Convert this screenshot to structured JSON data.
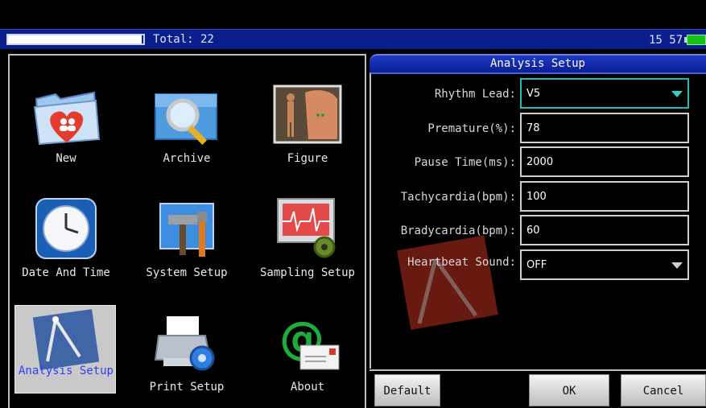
{
  "status_bar": {
    "progress_fraction": 0.99,
    "total_label": "Total: 22",
    "time": "15 57"
  },
  "menu": {
    "items": [
      {
        "label": "New",
        "icon": "new-folder-heart-icon"
      },
      {
        "label": "Archive",
        "icon": "archive-magnifier-icon"
      },
      {
        "label": "Figure",
        "icon": "figure-body-icon"
      },
      {
        "label": "Date And Time",
        "icon": "clock-icon"
      },
      {
        "label": "System Setup",
        "icon": "tools-icon"
      },
      {
        "label": "Sampling Setup",
        "icon": "monitor-gear-icon"
      },
      {
        "label": "Analysis Setup",
        "icon": "compass-blueprint-icon"
      },
      {
        "label": "Print Setup",
        "icon": "printer-gear-icon"
      },
      {
        "label": "About",
        "icon": "at-envelope-icon"
      }
    ],
    "selected": "Analysis Setup"
  },
  "analysis_setup": {
    "title": "Analysis Setup",
    "fields": [
      {
        "label": "Rhythm Lead:",
        "value": "V5",
        "type": "dropdown"
      },
      {
        "label": "Premature(%):",
        "value": "78",
        "type": "input"
      },
      {
        "label": "Pause Time(ms):",
        "value": "2000",
        "type": "input"
      },
      {
        "label": "Tachycardia(bpm):",
        "value": "100",
        "type": "input"
      },
      {
        "label": "Bradycardia(bpm):",
        "value": "60",
        "type": "input"
      },
      {
        "label": "Heartbeat Sound:",
        "value": "OFF",
        "type": "dropdown"
      }
    ],
    "buttons": {
      "default": "Default",
      "ok": "OK",
      "cancel": "Cancel"
    }
  },
  "colors": {
    "accent_blue": "#0a1e8c",
    "highlight_teal": "#25b8b8",
    "selected_text": "#2d3cff"
  }
}
